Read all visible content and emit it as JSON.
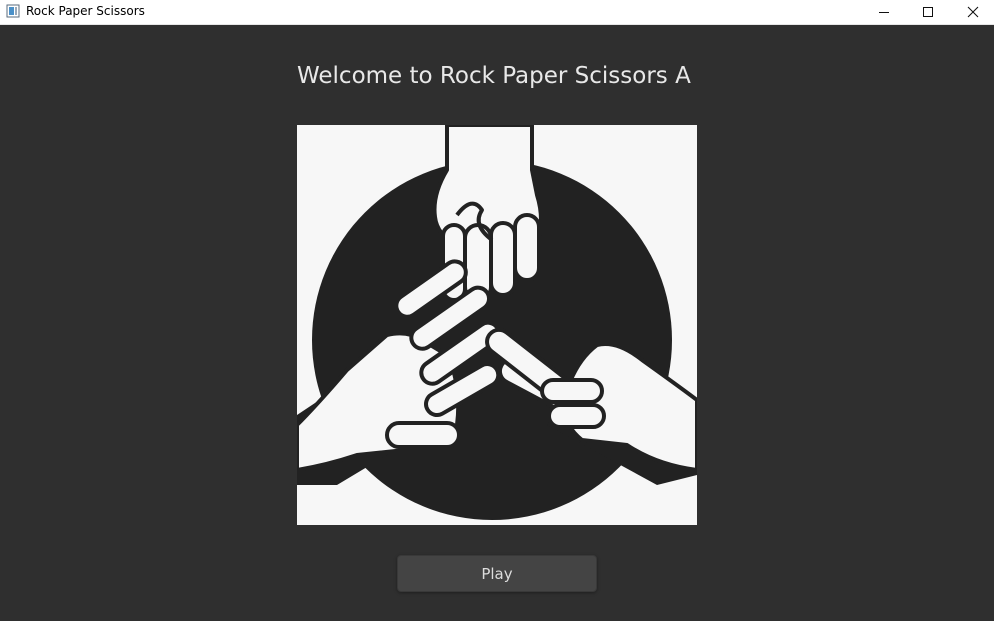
{
  "window": {
    "title": "Rock Paper Scissors",
    "controls": {
      "minimize": "minimize-icon",
      "maximize": "maximize-icon",
      "close": "close-icon"
    }
  },
  "main": {
    "welcome_text": "Welcome to Rock Paper Scissors A",
    "logo_icon": "rock-paper-scissors-hands-icon",
    "play_label": "Play"
  },
  "colors": {
    "background": "#2f2f2f",
    "titlebar": "#ffffff",
    "button": "#444444",
    "text": "#e8e8e8"
  }
}
